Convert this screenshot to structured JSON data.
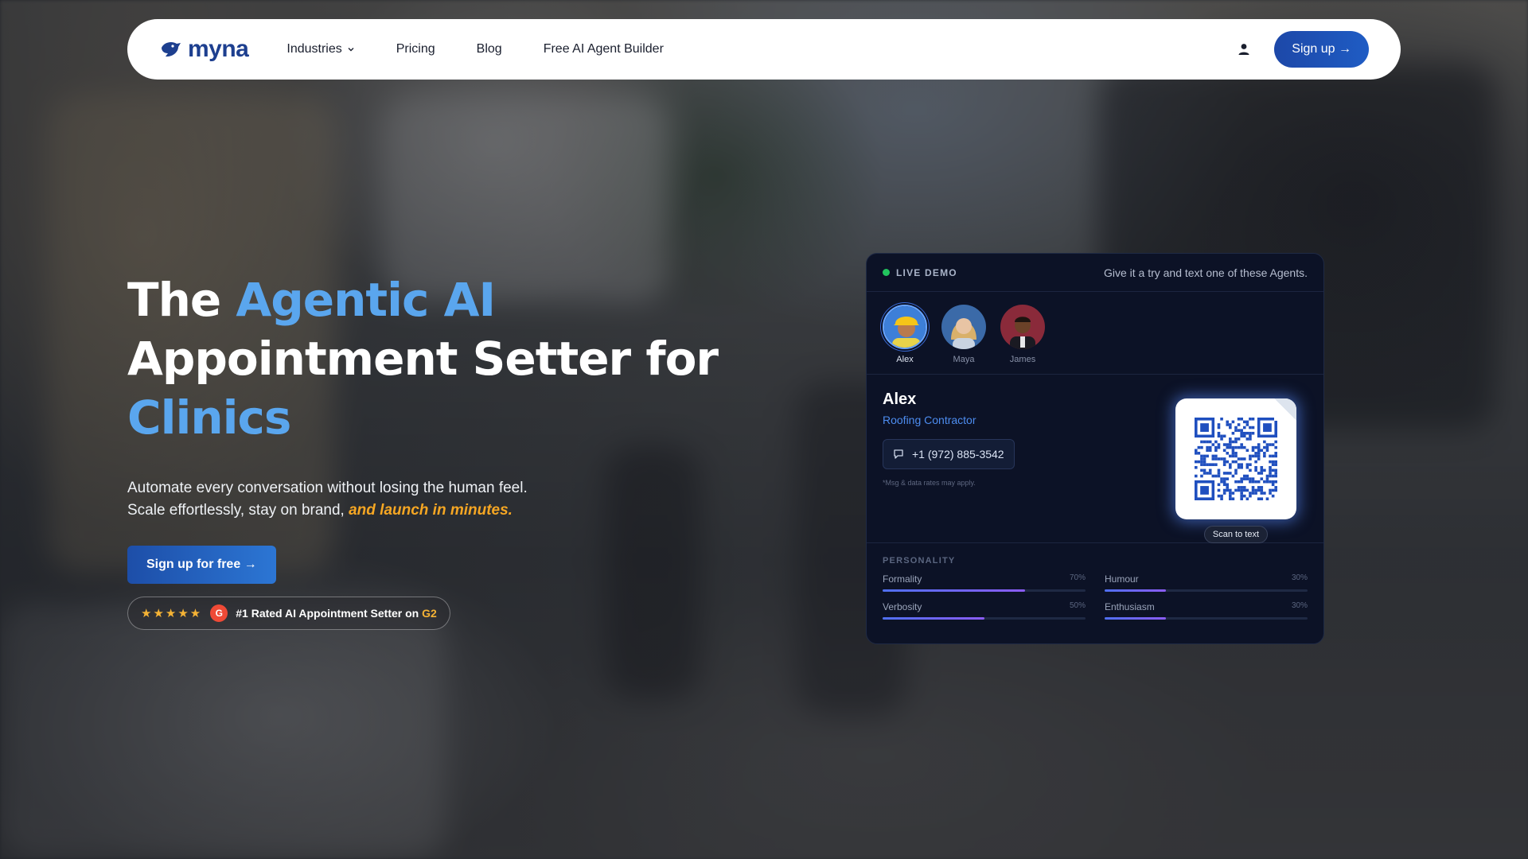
{
  "nav": {
    "logo_text": "myna",
    "links": [
      {
        "label": "Industries",
        "has_dropdown": true
      },
      {
        "label": "Pricing"
      },
      {
        "label": "Blog"
      },
      {
        "label": "Free AI Agent Builder"
      }
    ],
    "signup_label": "Sign up →",
    "user_icon": "user-icon"
  },
  "hero": {
    "headline_part1": "The ",
    "headline_accent1": "Agentic AI",
    "headline_part2": "Appointment Setter for",
    "headline_accent2": "Clinics",
    "sub_line1": "Automate every conversation without losing the human feel.",
    "sub_line2": "Scale effortlessly, stay on brand, ",
    "sub_accent": "and launch in minutes.",
    "cta_label": "Sign up for free →",
    "rated_stars": "★★★★★",
    "rated_badge": "G",
    "rated_text": "#1 Rated AI Appointment Setter on ",
    "rated_platform": "G2"
  },
  "demo": {
    "live_label": "LIVE DEMO",
    "head_note": "Give it a try and text one of these Agents.",
    "agents": [
      {
        "name": "Alex",
        "active": true
      },
      {
        "name": "Maya",
        "active": false
      },
      {
        "name": "James",
        "active": false
      }
    ],
    "selected": {
      "name": "Alex",
      "role": "Roofing Contractor",
      "phone": "+1 (972) 885-3542",
      "rates_note": "*Msg & data rates may apply.",
      "scan_label": "Scan to text"
    },
    "personality_label": "PERSONALITY",
    "traits": [
      {
        "name": "Formality",
        "value": "70%",
        "level": 0.7
      },
      {
        "name": "Humour",
        "value": "30%",
        "level": 0.3
      },
      {
        "name": "Verbosity",
        "value": "50%",
        "level": 0.5
      },
      {
        "name": "Enthusiasm",
        "value": "30%",
        "level": 0.3
      }
    ]
  },
  "colors": {
    "brand": "#1d3f8f",
    "accent_blue": "#5aa6ee",
    "accent_orange": "#f5a623",
    "live_green": "#22c55e"
  }
}
